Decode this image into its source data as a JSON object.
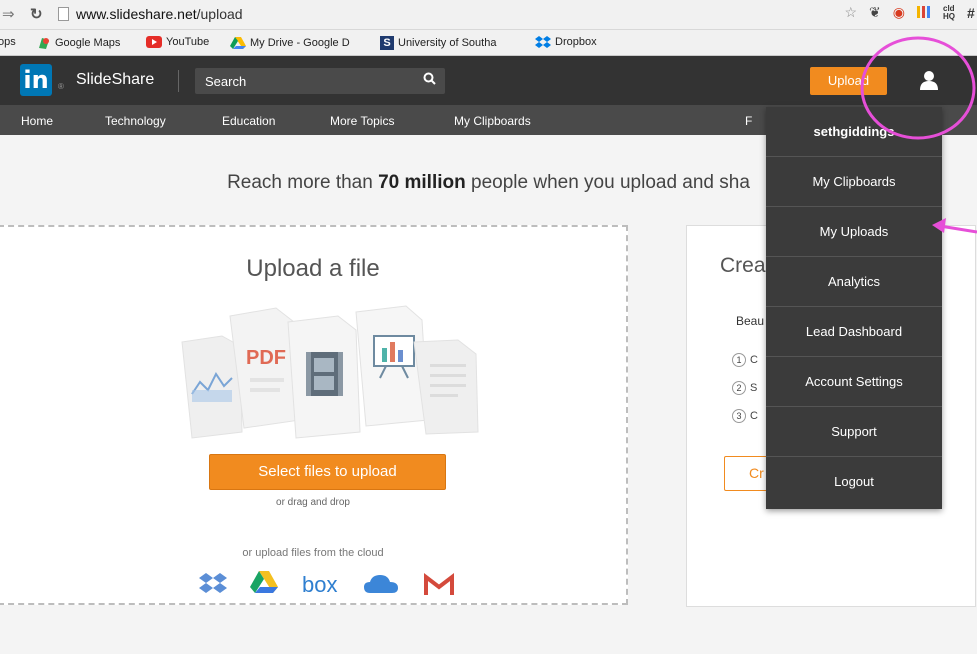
{
  "browser": {
    "url_domain": "www.slideshare.net",
    "url_path": "/upload",
    "bookmarks": [
      {
        "label": "ops",
        "color": "transparent"
      },
      {
        "label": "Google Maps",
        "color": "#34a853"
      },
      {
        "label": "YouTube",
        "color": "#e52d27"
      },
      {
        "label": "My Drive - Google D",
        "color": "#fbbc05"
      },
      {
        "label": "University of Southa",
        "color": "#1f3a6e"
      },
      {
        "label": "Dropbox",
        "color": "#007ee5"
      }
    ]
  },
  "header": {
    "logo_text": "SlideShare",
    "search_placeholder": "Search",
    "upload_label": "Upload"
  },
  "subnav": [
    "Home",
    "Technology",
    "Education",
    "More Topics",
    "My Clipboards",
    "F"
  ],
  "main": {
    "headline_pre": "Reach more than ",
    "headline_bold": "70 million",
    "headline_post": " people when you upload and sha",
    "upload_title": "Upload a file",
    "select_button": "Select files to upload",
    "drag_text": "or drag and drop",
    "cloud_text": "or upload files from the cloud",
    "cloud_services": [
      "dropbox-icon",
      "google-drive-icon",
      "box-icon",
      "onedrive-icon",
      "gmail-icon"
    ],
    "file_types": [
      "chart-file-icon",
      "pdf-file-icon",
      "video-file-icon",
      "presentation-file-icon",
      "document-file-icon"
    ]
  },
  "create": {
    "title": "Crea",
    "subtitle": "Beau",
    "steps": [
      {
        "num": "1",
        "text": "C"
      },
      {
        "num": "2",
        "text": "S"
      },
      {
        "num": "3",
        "text": "C"
      }
    ],
    "button": "Cr"
  },
  "dropdown": {
    "items": [
      "sethgiddings",
      "My Clipboards",
      "My Uploads",
      "Analytics",
      "Lead Dashboard",
      "Account Settings",
      "Support",
      "Logout"
    ]
  },
  "colors": {
    "accent": "#f18b1f",
    "annotation": "#e64fd8",
    "linkedin": "#0077b5"
  }
}
